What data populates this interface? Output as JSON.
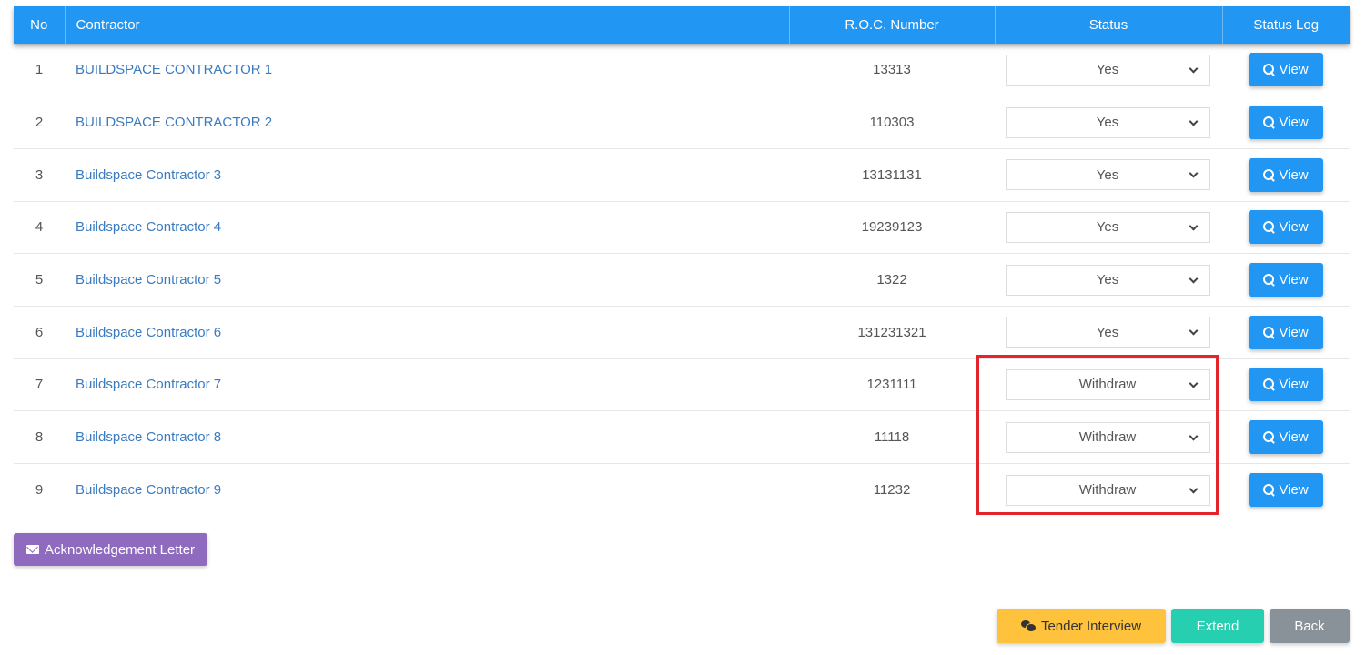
{
  "table": {
    "headers": {
      "no": "No",
      "contractor": "Contractor",
      "roc": "R.O.C. Number",
      "status": "Status",
      "status_log": "Status Log"
    },
    "rows": [
      {
        "no": "1",
        "contractor": "BUILDSPACE CONTRACTOR 1",
        "roc": "13313",
        "status": "Yes",
        "view": "View"
      },
      {
        "no": "2",
        "contractor": "BUILDSPACE CONTRACTOR 2",
        "roc": "110303",
        "status": "Yes",
        "view": "View"
      },
      {
        "no": "3",
        "contractor": "Buildspace Contractor 3",
        "roc": "13131131",
        "status": "Yes",
        "view": "View"
      },
      {
        "no": "4",
        "contractor": "Buildspace Contractor 4",
        "roc": "19239123",
        "status": "Yes",
        "view": "View"
      },
      {
        "no": "5",
        "contractor": "Buildspace Contractor 5",
        "roc": "1322",
        "status": "Yes",
        "view": "View"
      },
      {
        "no": "6",
        "contractor": "Buildspace Contractor 6",
        "roc": "131231321",
        "status": "Yes",
        "view": "View"
      },
      {
        "no": "7",
        "contractor": "Buildspace Contractor 7",
        "roc": "1231111",
        "status": "Withdraw",
        "view": "View"
      },
      {
        "no": "8",
        "contractor": "Buildspace Contractor 8",
        "roc": "11118",
        "status": "Withdraw",
        "view": "View"
      },
      {
        "no": "9",
        "contractor": "Buildspace Contractor 9",
        "roc": "11232",
        "status": "Withdraw",
        "view": "View"
      }
    ]
  },
  "buttons": {
    "acknowledgement_letter": "Acknowledgement Letter",
    "tender_interview": "Tender Interview",
    "extend": "Extend",
    "back": "Back"
  },
  "icons": {
    "view": "search-icon",
    "acknowledgement": "envelope-icon",
    "tender_interview": "chat-icon",
    "status_select": "chevron-down-icon"
  },
  "colors": {
    "header_bg": "#2196f3",
    "link": "#3a7bbf",
    "view_button": "#2196f3",
    "ack_button": "#8e6bbf",
    "tender_button": "#ffc23d",
    "extend_button": "#26cfb0",
    "back_button": "#8a9299",
    "highlight_box": "#e3242b"
  }
}
